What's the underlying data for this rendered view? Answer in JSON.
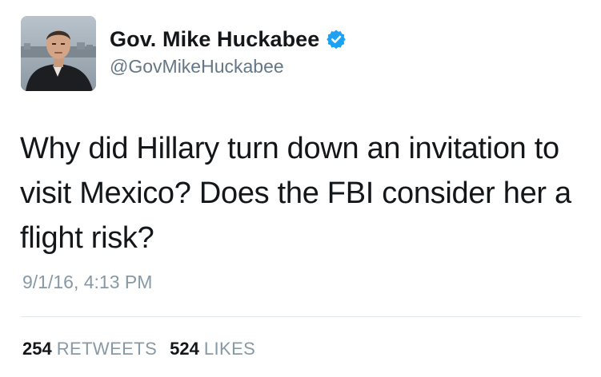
{
  "user": {
    "display_name": "Gov. Mike Huckabee",
    "handle": "@GovMikeHuckabee",
    "verified_icon": "verified-badge-icon",
    "avatar_icon": "profile-photo"
  },
  "tweet": {
    "text": "Why did Hillary turn down an invitation to visit Mexico? Does the FBI consider her a flight risk?",
    "timestamp": "9/1/16, 4:13 PM"
  },
  "stats": {
    "retweets_count": "254",
    "retweets_label": "RETWEETS",
    "likes_count": "524",
    "likes_label": "LIKES"
  },
  "colors": {
    "verified_blue": "#1da1f2",
    "muted_text": "#8899a6",
    "handle_text": "#657786",
    "primary_text": "#14171a",
    "divider": "#e1e8ed"
  }
}
